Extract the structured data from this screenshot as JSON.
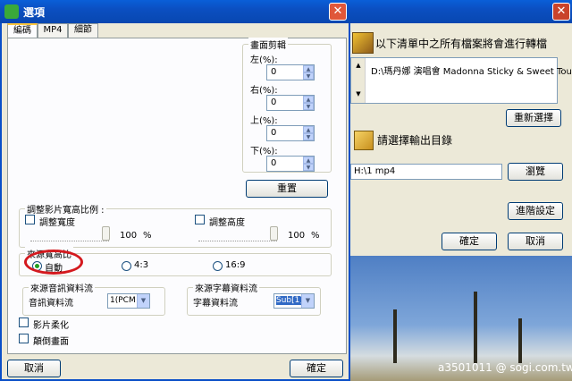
{
  "background_window": {
    "file_list_heading": "以下清單中之所有檔案將會進行轉檔",
    "file_entry": "D:\\瑪丹娜 演唱會 Madonna Sticky & Sweet Tour\\V",
    "reselect_button": "重新選擇",
    "output_heading": "請選擇輸出目錄",
    "output_path": "H:\\1 mp4",
    "browse_button": "瀏覽",
    "advanced_button": "進階設定",
    "ok_button": "確定",
    "cancel_button": "取消",
    "watermark": "a3501011   @ sogi.com.tw"
  },
  "dialog": {
    "title": "選項",
    "close": "✕",
    "tabs": [
      "編碼",
      "MP4",
      "細節"
    ],
    "crop": {
      "label": "畫面剪輯",
      "left_label": "左(%):",
      "left_value": "0",
      "right_label": "右(%):",
      "right_value": "0",
      "top_label": "上(%):",
      "top_value": "0",
      "bottom_label": "下(%):",
      "bottom_value": "0",
      "reset_button": "重置"
    },
    "scale": {
      "label": "調整影片寬高比例 :",
      "width_check": "調整寬度",
      "height_check": "調整高度",
      "width_value": "100",
      "height_value": "100",
      "unit": "%"
    },
    "aspect": {
      "label": "來源寬高比",
      "options": [
        "自動",
        "4:3",
        "16:9"
      ],
      "selected": "自動"
    },
    "audio": {
      "label": "來源音訊資料流",
      "field_label": "音訊資料流",
      "value": "1(PCM"
    },
    "subtitle": {
      "label": "來源字幕資料流",
      "field_label": "字幕資料流",
      "value": "Sub[1]"
    },
    "soften": "影片柔化",
    "flip": "顛倒畫面",
    "cancel_button": "取消",
    "ok_button": "確定"
  }
}
